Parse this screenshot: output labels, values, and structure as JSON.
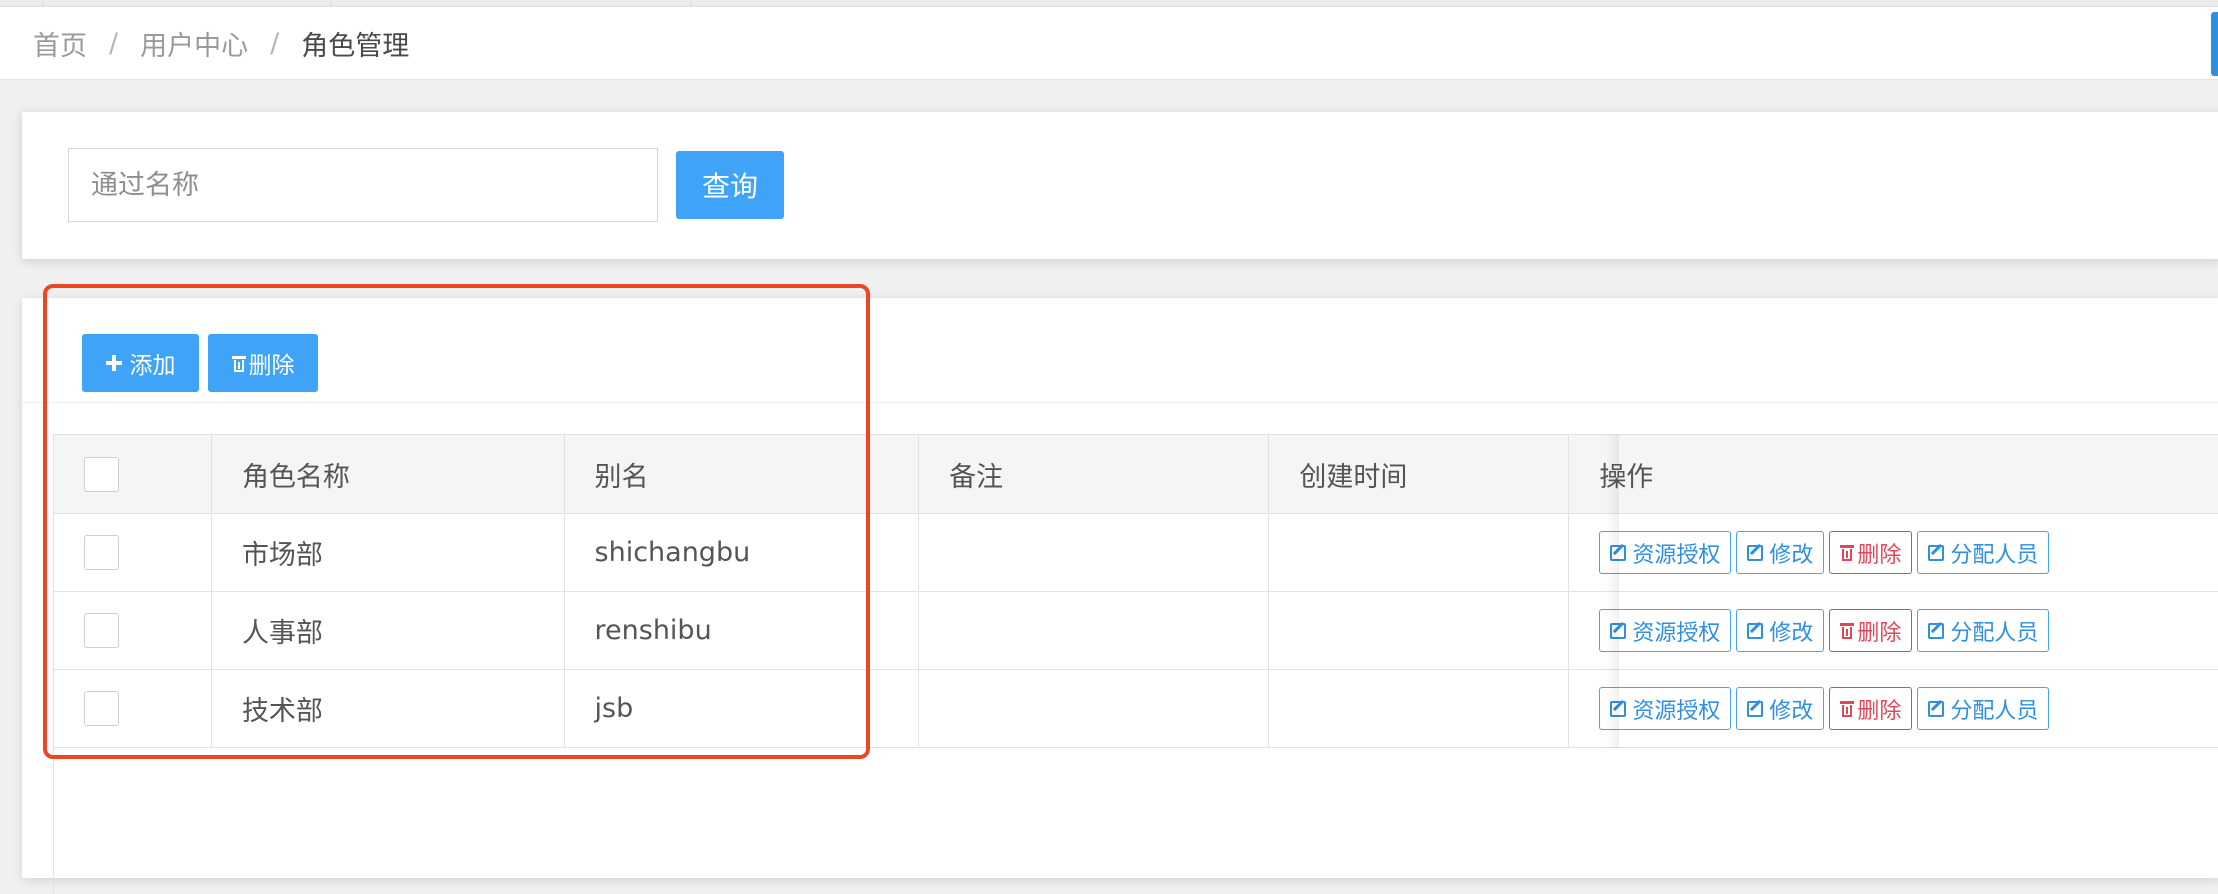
{
  "breadcrumb": {
    "items": [
      "首页",
      "用户中心",
      "角色管理"
    ],
    "separator": "/"
  },
  "search": {
    "placeholder": "通过名称",
    "button_label": "查询"
  },
  "toolbar": {
    "add_label": "添加",
    "delete_label": "删除"
  },
  "table": {
    "headers": [
      "角色名称",
      "别名",
      "备注",
      "创建时间",
      "操作"
    ],
    "rows": [
      {
        "name": "市场部",
        "alias": "shichangbu",
        "remark": "",
        "created": ""
      },
      {
        "name": "人事部",
        "alias": "renshibu",
        "remark": "",
        "created": ""
      },
      {
        "name": "技术部",
        "alias": "jsb",
        "remark": "",
        "created": ""
      }
    ],
    "actions": {
      "authorize": "资源授权",
      "edit": "修改",
      "delete": "删除",
      "assign": "分配人员"
    }
  },
  "colors": {
    "primary": "#3fa3f7",
    "danger": "#e0475b",
    "highlight": "#ee4622"
  }
}
